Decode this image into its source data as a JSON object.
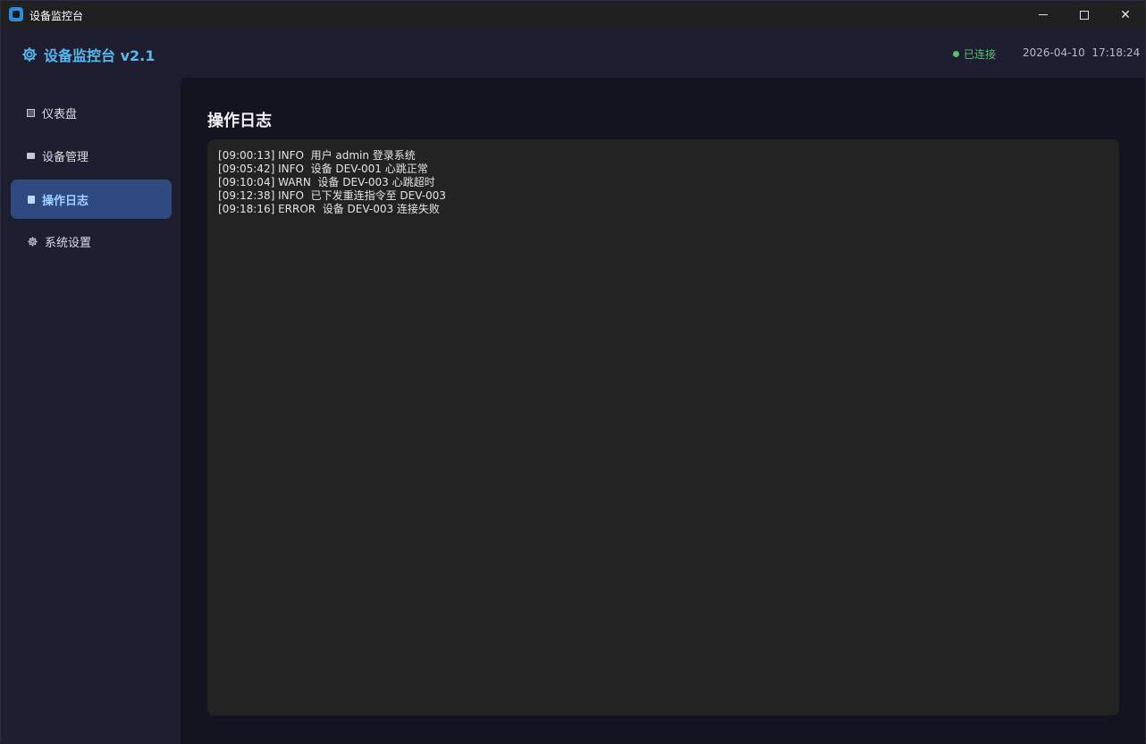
{
  "window": {
    "title": "设备监控台",
    "controls": {
      "minimize": "",
      "maximize": "",
      "close": "✕"
    }
  },
  "header": {
    "title": "设备监控台 v2.1",
    "status": "已连接",
    "status_color": "#4ec46a",
    "datetime": "2026-04-10  17:18:24"
  },
  "sidebar": {
    "items": [
      {
        "label": "仪表盘",
        "icon": "dashboard-icon"
      },
      {
        "label": "设备管理",
        "icon": "device-icon"
      },
      {
        "label": "操作日志",
        "icon": "log-icon",
        "active": true
      },
      {
        "label": "系统设置",
        "icon": "gear-icon"
      }
    ]
  },
  "main": {
    "title": "操作日志",
    "logs": [
      "[09:00:13] INFO  用户 admin 登录系统",
      "[09:05:42] INFO  设备 DEV-001 心跳正常",
      "[09:10:04] WARN  设备 DEV-003 心跳超时",
      "[09:12:38] INFO  已下发重连指令至 DEV-003",
      "[09:18:16] ERROR  设备 DEV-003 连接失败"
    ]
  },
  "colors": {
    "accent": "#58b8f0",
    "active_nav_bg": "#2e4a7e",
    "active_nav_text": "#9fd0ff"
  }
}
